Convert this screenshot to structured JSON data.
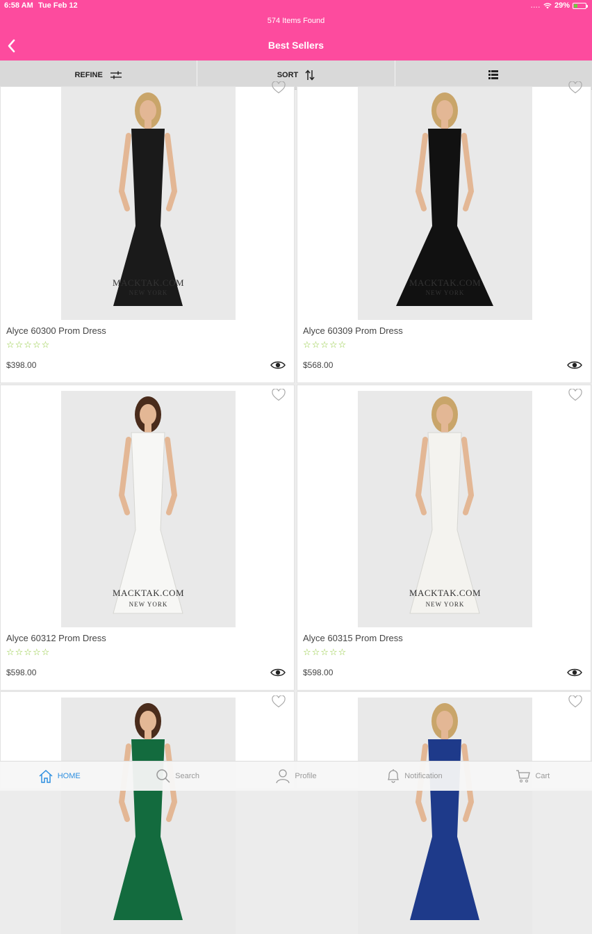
{
  "status": {
    "time": "6:58 AM",
    "date": "Tue Feb 12",
    "battery": "29%",
    "dots": "....",
    "battery_level": 0.29
  },
  "header": {
    "items_found": "574 Items Found",
    "title": "Best Sellers"
  },
  "toolbar": {
    "refine_label": "REFINE",
    "sort_label": "SORT"
  },
  "watermark": {
    "line1": "MACKTAK.COM",
    "line2": "NEW YORK"
  },
  "products": [
    {
      "name": "Alyce 60300 Prom Dress",
      "rating": "☆☆☆☆☆",
      "price": "$398.00",
      "dress_color": "#1a1a1a"
    },
    {
      "name": "Alyce 60309 Prom Dress",
      "rating": "☆☆☆☆☆",
      "price": "$568.00",
      "dress_color": "#111111"
    },
    {
      "name": "Alyce 60312 Prom Dress",
      "rating": "☆☆☆☆☆",
      "price": "$598.00",
      "dress_color": "#f7f7f5"
    },
    {
      "name": "Alyce 60315 Prom Dress",
      "rating": "☆☆☆☆☆",
      "price": "$598.00",
      "dress_color": "#f4f3ef"
    },
    {
      "name": "",
      "rating": "",
      "price": "",
      "dress_color": "#136b3e"
    },
    {
      "name": "",
      "rating": "",
      "price": "",
      "dress_color": "#1e3a8a"
    }
  ],
  "tabbar": [
    {
      "label": "HOME",
      "icon": "home-icon",
      "active": true
    },
    {
      "label": "Search",
      "icon": "search-icon",
      "active": false
    },
    {
      "label": "Profile",
      "icon": "profile-icon",
      "active": false
    },
    {
      "label": "Notification",
      "icon": "bell-icon",
      "active": false
    },
    {
      "label": "Cart",
      "icon": "cart-icon",
      "active": false
    }
  ],
  "colors": {
    "brand": "#fd4b9e",
    "star": "#8fc93a",
    "tab_active": "#2d8fe0"
  }
}
